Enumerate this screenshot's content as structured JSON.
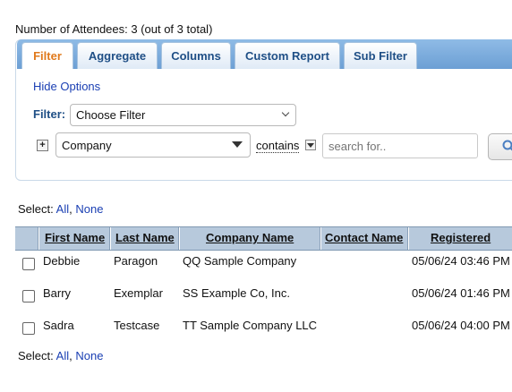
{
  "header": {
    "attendee_count": "Number of Attendees: 3 (out of 3 total)"
  },
  "tabs": [
    {
      "label": "Filter",
      "active": true
    },
    {
      "label": "Aggregate",
      "active": false
    },
    {
      "label": "Columns",
      "active": false
    },
    {
      "label": "Custom Report",
      "active": false
    },
    {
      "label": "Sub Filter",
      "active": false
    }
  ],
  "filter": {
    "hide_options": "Hide Options",
    "filter_label": "Filter:",
    "filter_select_value": "Choose Filter",
    "field_select_value": "Company",
    "operator": "contains",
    "search_placeholder": "search for.."
  },
  "select_links": {
    "label": "Select:",
    "all": "All",
    "separator": ",",
    "none": "None"
  },
  "table": {
    "columns": [
      "First Name",
      "Last Name",
      "Company Name",
      "Contact Name",
      "Registered"
    ],
    "rows": [
      {
        "first": "Debbie",
        "last": "Paragon",
        "company": "QQ Sample Company",
        "contact": "",
        "registered": "05/06/24 03:46 PM"
      },
      {
        "first": "Barry",
        "last": "Exemplar",
        "company": "SS Example Co, Inc.",
        "contact": "",
        "registered": "05/06/24 01:46 PM"
      },
      {
        "first": "Sadra",
        "last": "Testcase",
        "company": "TT Sample Company LLC",
        "contact": "",
        "registered": "05/06/24 04:00 PM"
      }
    ]
  },
  "colors": {
    "tab_bar": "#7aa9da",
    "active_tab_text": "#e0791b",
    "header_bg": "#b7c9dc",
    "link": "#1a3fb3"
  },
  "icons": [
    "expand-plus-icon",
    "dropdown-triangle-icon",
    "chevron-down-icon",
    "search-icon"
  ]
}
